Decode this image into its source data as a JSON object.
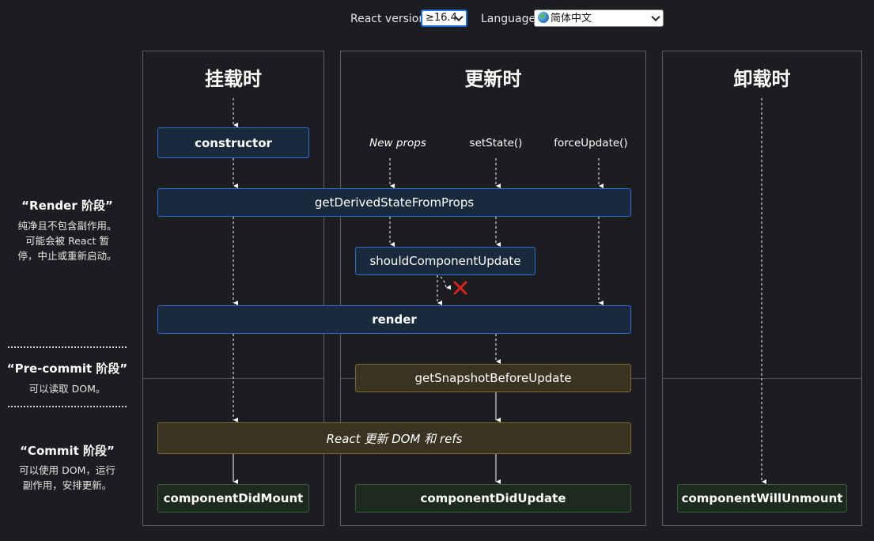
{
  "topbar": {
    "version_label": "React version",
    "version_value": "≥16.4",
    "language_label": "Language",
    "language_value": "简体中文"
  },
  "columns": {
    "mounting": "挂载时",
    "updating": "更新时",
    "unmounting": "卸载时"
  },
  "phases": {
    "render_title": "“Render 阶段”",
    "render_desc_1": "纯净且不包含副作用。",
    "render_desc_2": "可能会被 React 暂",
    "render_desc_3": "停，中止或重新启动。",
    "precommit_title": "“Pre-commit 阶段”",
    "precommit_desc": "可以读取 DOM。",
    "commit_title": "“Commit 阶段”",
    "commit_desc_1": "可以使用 DOM，运行",
    "commit_desc_2": "副作用，安排更新。"
  },
  "triggers": {
    "new_props": "New props",
    "set_state": "setState()",
    "force_update": "forceUpdate()"
  },
  "boxes": {
    "constructor": "constructor",
    "get_derived_state": "getDerivedStateFromProps",
    "should_update": "shouldComponentUpdate",
    "render": "render",
    "get_snapshot": "getSnapshotBeforeUpdate",
    "react_updates_dom": "React 更新 DOM 和 refs",
    "did_mount": "componentDidMount",
    "did_update": "componentDidUpdate",
    "will_unmount": "componentWillUnmount"
  },
  "colors": {
    "background": "#1b1d20",
    "render_box": "#2a6fd1",
    "commit_box": "#7d6a2e",
    "lifecycle_end_box": "#3b5c3a",
    "cancel_mark": "#e0201b"
  }
}
